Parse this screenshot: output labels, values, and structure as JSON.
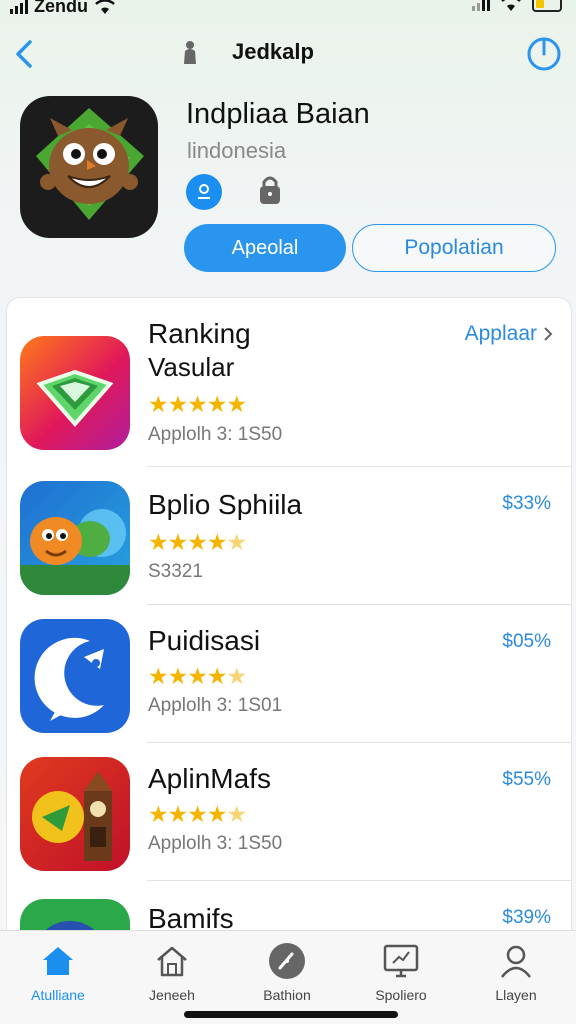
{
  "status_bar": {
    "carrier": "Zendu"
  },
  "nav": {
    "title": "Jedkalp"
  },
  "header": {
    "title": "Indpliaa Baian",
    "subtitle": "lindonesia",
    "primary_button": "Apeolal",
    "secondary_button": "Popolatian"
  },
  "list": [
    {
      "title": "Ranking",
      "subtitle": "Vasular",
      "rating": 5,
      "meta": "Applolh 3: 1S50",
      "link": "Applaar",
      "icon": "gem-icon"
    },
    {
      "title": "Bplio Sphiila",
      "rating": 4.5,
      "meta": "S3321",
      "price": "$33%",
      "icon": "cartoon-fish-icon"
    },
    {
      "title": "Puidisasi",
      "rating": 4.5,
      "meta": "Applolh 3: 1S01",
      "price": "$05%",
      "icon": "moon-chat-icon"
    },
    {
      "title": "AplinMafs",
      "rating": 4.5,
      "meta": "Applolh 3: 1S50",
      "price": "$55%",
      "icon": "map-tower-icon"
    },
    {
      "title": "Bamifs",
      "price": "$39%",
      "icon": "character-icon"
    }
  ],
  "tabs": [
    {
      "label": "Atulliane",
      "icon": "home-icon",
      "active": true
    },
    {
      "label": "Jeneeh",
      "icon": "house-outline-icon"
    },
    {
      "label": "Bathion",
      "icon": "compass-icon"
    },
    {
      "label": "Spoliero",
      "icon": "chart-board-icon"
    },
    {
      "label": "Llayen",
      "icon": "person-icon"
    }
  ],
  "colors": {
    "accent": "#2a95ef",
    "star": "#f4b400",
    "price": "#2a8ae0"
  }
}
